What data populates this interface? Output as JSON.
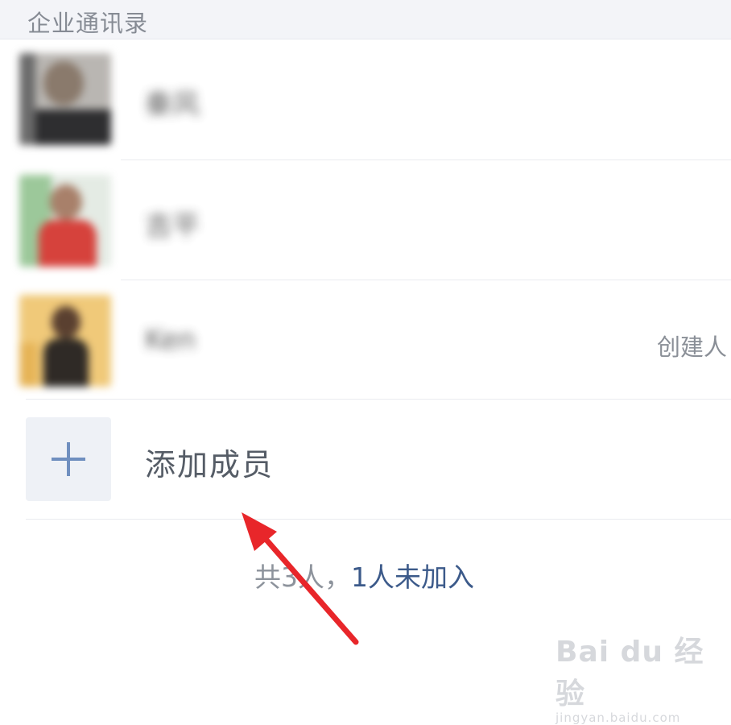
{
  "section": {
    "title": "企业通讯录"
  },
  "members": [
    {
      "name": "秦风",
      "role": ""
    },
    {
      "name": "吉平",
      "role": ""
    },
    {
      "name": "Ken",
      "role": "创建人"
    }
  ],
  "add_member": {
    "label": "添加成员",
    "icon": "plus-icon"
  },
  "summary": {
    "total_text": "共3人，",
    "pending_text": "1人未加入"
  },
  "watermark": {
    "main": "Bai du 经验",
    "sub": "jingyan.baidu.com"
  },
  "colors": {
    "accent": "#3c5a8a",
    "plus": "#6f8fbf",
    "arrow": "#e8262a",
    "header_bg": "#f3f4f8"
  }
}
